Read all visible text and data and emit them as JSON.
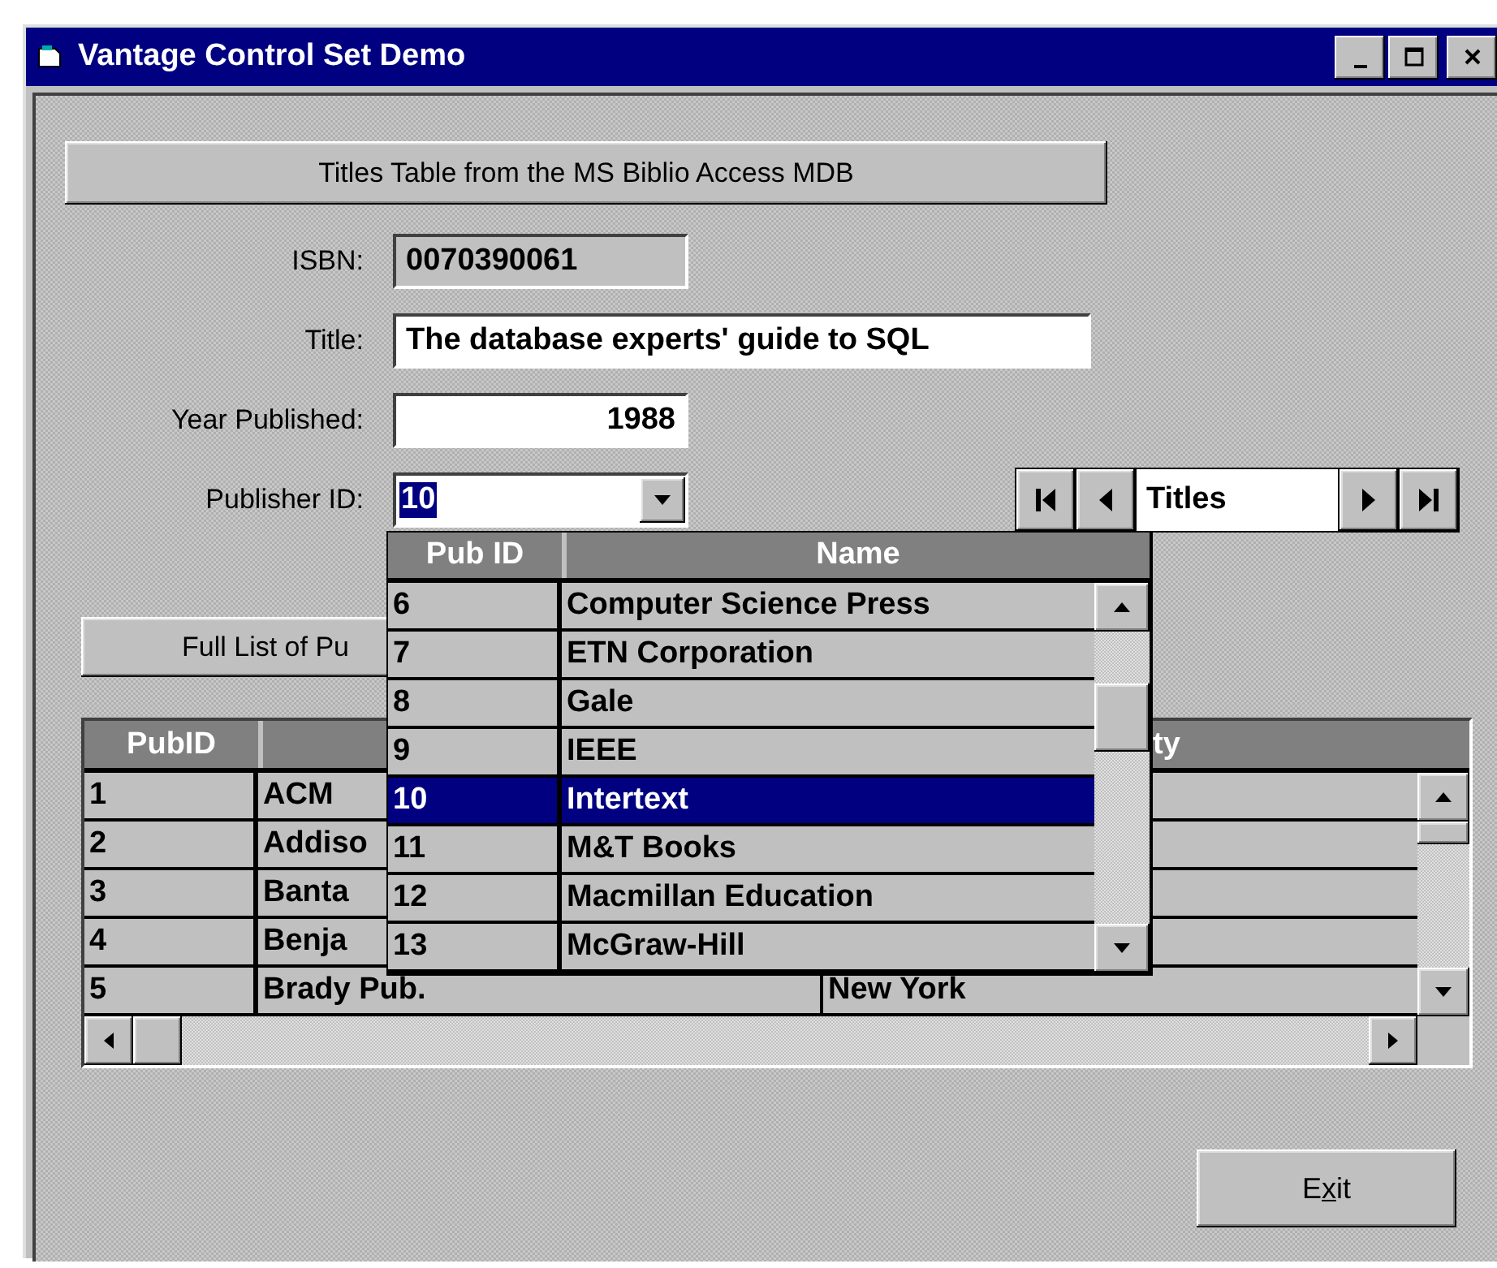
{
  "window": {
    "title": "Vantage Control Set Demo"
  },
  "titles_button": {
    "label": "Titles Table from the MS Biblio Access MDB"
  },
  "fields": [
    {
      "label": "ISBN:",
      "value": "0070390061",
      "kind": "readonly"
    },
    {
      "label": "Title:",
      "value": "The database experts' guide to SQL",
      "kind": "text"
    },
    {
      "label": "Year Published:",
      "value": "1988",
      "kind": "number"
    }
  ],
  "publisher": {
    "label": "Publisher ID:",
    "value": "10"
  },
  "navigator": {
    "caption": "Titles"
  },
  "publisher_list": {
    "columns": [
      "Pub ID",
      "Name"
    ],
    "rows": [
      {
        "cells": [
          "6",
          "Computer Science Press"
        ],
        "selected": false
      },
      {
        "cells": [
          "7",
          "ETN Corporation"
        ],
        "selected": false
      },
      {
        "cells": [
          "8",
          "Gale"
        ],
        "selected": false
      },
      {
        "cells": [
          "9",
          "IEEE"
        ],
        "selected": false
      },
      {
        "cells": [
          "10",
          "Intertext"
        ],
        "selected": true
      },
      {
        "cells": [
          "11",
          "M&T Books"
        ],
        "selected": false
      },
      {
        "cells": [
          "12",
          "Macmillan Education"
        ],
        "selected": false
      },
      {
        "cells": [
          "13",
          "McGraw-Hill"
        ],
        "selected": false
      }
    ]
  },
  "list_button": {
    "label": "Full List of Pu"
  },
  "grid": {
    "column_1": "PubID",
    "column_3": "ty",
    "rows": [
      [
        "1",
        "ACM"
      ],
      [
        "2",
        "Addiso"
      ],
      [
        "3",
        "Banta"
      ],
      [
        "4",
        "Benja"
      ],
      [
        "5",
        "Brady Pub.",
        "New York"
      ]
    ]
  },
  "exit_button": {
    "label": "Exit"
  }
}
